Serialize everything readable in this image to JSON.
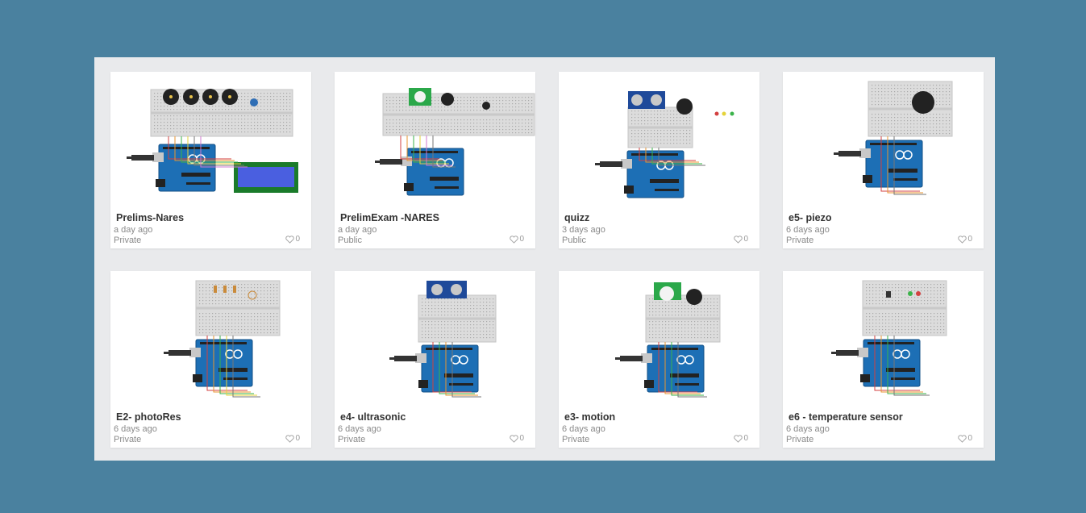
{
  "colors": {
    "background": "#4a819f",
    "panel": "#e9eaec",
    "card": "#ffffff",
    "arduino": "#1d6fb5",
    "breadboard": "#dcdcdc"
  },
  "projects": [
    {
      "title": "Prelims-Nares",
      "date": "a day ago",
      "visibility": "Private",
      "likes": "0",
      "thumbnail": "circuit-thumbnail"
    },
    {
      "title": "PrelimExam -NARES",
      "date": "a day ago",
      "visibility": "Public",
      "likes": "0",
      "thumbnail": "circuit-thumbnail"
    },
    {
      "title": "quizz",
      "date": "3 days ago",
      "visibility": "Public",
      "likes": "0",
      "thumbnail": "circuit-thumbnail"
    },
    {
      "title": "e5- piezo",
      "date": "6 days ago",
      "visibility": "Private",
      "likes": "0",
      "thumbnail": "circuit-thumbnail"
    },
    {
      "title": "E2- photoRes",
      "date": "6 days ago",
      "visibility": "Private",
      "likes": "0",
      "thumbnail": "circuit-thumbnail"
    },
    {
      "title": "e4- ultrasonic",
      "date": "6 days ago",
      "visibility": "Private",
      "likes": "0",
      "thumbnail": "circuit-thumbnail"
    },
    {
      "title": "e3- motion",
      "date": "6 days ago",
      "visibility": "Private",
      "likes": "0",
      "thumbnail": "circuit-thumbnail"
    },
    {
      "title": "e6 - temperature sensor",
      "date": "6 days ago",
      "visibility": "Private",
      "likes": "0",
      "thumbnail": "circuit-thumbnail"
    }
  ]
}
